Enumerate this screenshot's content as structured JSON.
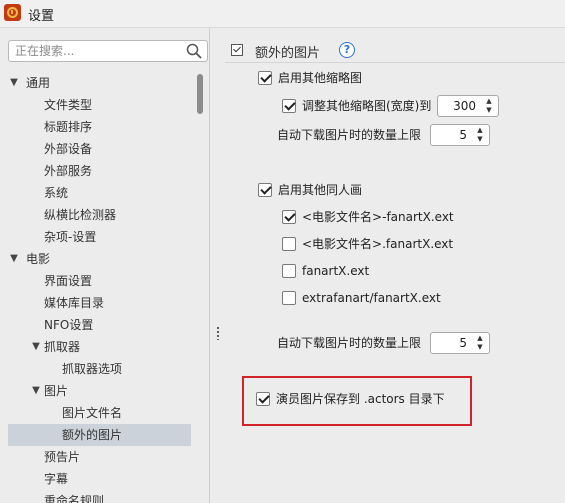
{
  "window": {
    "title": "设置"
  },
  "search": {
    "placeholder": "正在搜索..."
  },
  "sidebar": {
    "items": [
      {
        "label": "通用",
        "level": 0,
        "arrow": "▼"
      },
      {
        "label": "文件类型",
        "level": 1
      },
      {
        "label": "标题排序",
        "level": 1
      },
      {
        "label": "外部设备",
        "level": 1
      },
      {
        "label": "外部服务",
        "level": 1
      },
      {
        "label": "系统",
        "level": 1
      },
      {
        "label": "纵横比检测器",
        "level": 1
      },
      {
        "label": "杂项-设置",
        "level": 1
      },
      {
        "label": "电影",
        "level": 0,
        "arrow": "▼"
      },
      {
        "label": "界面设置",
        "level": 1
      },
      {
        "label": "媒体库目录",
        "level": 1
      },
      {
        "label": "NFO设置",
        "level": 1
      },
      {
        "label": "抓取器",
        "level": 1,
        "arrow": "▼"
      },
      {
        "label": "抓取器选项",
        "level": 2
      },
      {
        "label": "图片",
        "level": 1,
        "arrow": "▼"
      },
      {
        "label": "图片文件名",
        "level": 2
      },
      {
        "label": "额外的图片",
        "level": 2,
        "selected": true
      },
      {
        "label": "预告片",
        "level": 1
      },
      {
        "label": "字幕",
        "level": 1
      },
      {
        "label": "重命名规则",
        "level": 1
      }
    ]
  },
  "section": {
    "title": "额外的图片",
    "help": "?"
  },
  "options": {
    "enable_thumbs": {
      "label": "启用其他缩略图",
      "checked": true
    },
    "resize_thumbs": {
      "label": "调整其他缩略图(宽度)到",
      "checked": true,
      "value": "300"
    },
    "thumbs_limit": {
      "label": "自动下载图片时的数量上限",
      "value": "5"
    },
    "enable_fanart": {
      "label": "启用其他同人画",
      "checked": true
    },
    "fanart_1": {
      "label": "<电影文件名>-fanartX.ext",
      "checked": true
    },
    "fanart_2": {
      "label": "<电影文件名>.fanartX.ext",
      "checked": false
    },
    "fanart_3": {
      "label": "fanartX.ext",
      "checked": false
    },
    "fanart_4": {
      "label": "extrafanart/fanartX.ext",
      "checked": false
    },
    "fanart_limit": {
      "label": "自动下载图片时的数量上限",
      "value": "5"
    },
    "actor_images": {
      "label": "演员图片保存到 .actors 目录下",
      "checked": true
    }
  },
  "colors": {
    "highlight": "#d2232a",
    "selected_row": "#cbd2da",
    "help_blue": "#2f6fd6"
  }
}
